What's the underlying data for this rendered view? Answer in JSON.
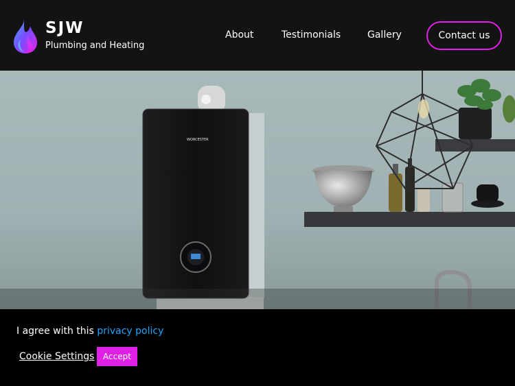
{
  "header": {
    "brand_name": "SJW",
    "brand_tagline": "Plumbing and Heating",
    "nav": {
      "about": "About",
      "testimonials": "Testimonials",
      "gallery": "Gallery",
      "contact": "Contact us"
    }
  },
  "hero": {
    "boiler_brand": "WORCESTER"
  },
  "cookie_bar": {
    "text": "I agree with this ",
    "link": "privacy policy",
    "settings": "Cookie Settings",
    "accept": "Accept"
  },
  "colors": {
    "accent": "#e020e6",
    "link": "#1aa7ff",
    "header_bg": "#131313"
  }
}
